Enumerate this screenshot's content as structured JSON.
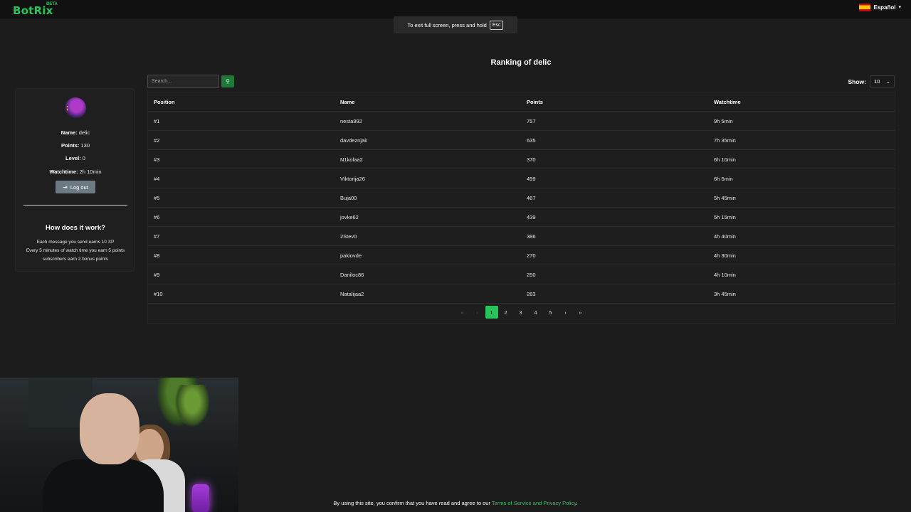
{
  "brand": {
    "logo": "BotRix",
    "badge": "BETA"
  },
  "language": {
    "label": "Español",
    "flag": "spain-flag-icon"
  },
  "fullscreen_toast": {
    "text": "To exit full screen, press and hold",
    "key": "Esc"
  },
  "page_title": "Ranking of delic",
  "profile": {
    "name_label": "Name:",
    "name_value": "delic",
    "points_label": "Points:",
    "points_value": "130",
    "level_label": "Level:",
    "level_value": "0",
    "watchtime_label": "Watchtime:",
    "watchtime_value": "2h 10min",
    "logout_label": "Log out"
  },
  "how": {
    "title": "How does it work?",
    "lines": [
      "Each message you send earns 10 XP",
      "Every 5 minutes of watch time you earn 5 points",
      "subscribers earn 2 bonus points"
    ]
  },
  "search": {
    "placeholder": "Search..."
  },
  "show": {
    "label": "Show:",
    "value": "10"
  },
  "table": {
    "columns": [
      "Position",
      "Name",
      "Points",
      "Watchtime"
    ],
    "rows": [
      [
        "#1",
        "nesta992",
        "757",
        "9h 5min"
      ],
      [
        "#2",
        "davdeznjak",
        "635",
        "7h 35min"
      ],
      [
        "#3",
        "N1kolaa2",
        "370",
        "6h 10min"
      ],
      [
        "#4",
        "Viktorija26",
        "499",
        "6h 5min"
      ],
      [
        "#5",
        "Buja00",
        "467",
        "5h 45min"
      ],
      [
        "#6",
        "jovke62",
        "439",
        "5h 15min"
      ],
      [
        "#7",
        "2Stev0",
        "386",
        "4h 40min"
      ],
      [
        "#8",
        "pakiovde",
        "270",
        "4h 30min"
      ],
      [
        "#9",
        "Daniloc86",
        "250",
        "4h 10min"
      ],
      [
        "#10",
        "Natalijaa2",
        "283",
        "3h 45min"
      ]
    ]
  },
  "pagination": {
    "first": "«",
    "prev": "‹",
    "pages": [
      "1",
      "2",
      "3",
      "4",
      "5"
    ],
    "active": "1",
    "next": "›",
    "last": "»"
  },
  "footer": {
    "text": "By using this site, you confirm that you have read and agree to our ",
    "link": "Terms of Service and Privacy Policy",
    "end": "."
  },
  "colors": {
    "accent": "#27c45c",
    "background": "#1c1c1c",
    "navbar": "#111111"
  }
}
